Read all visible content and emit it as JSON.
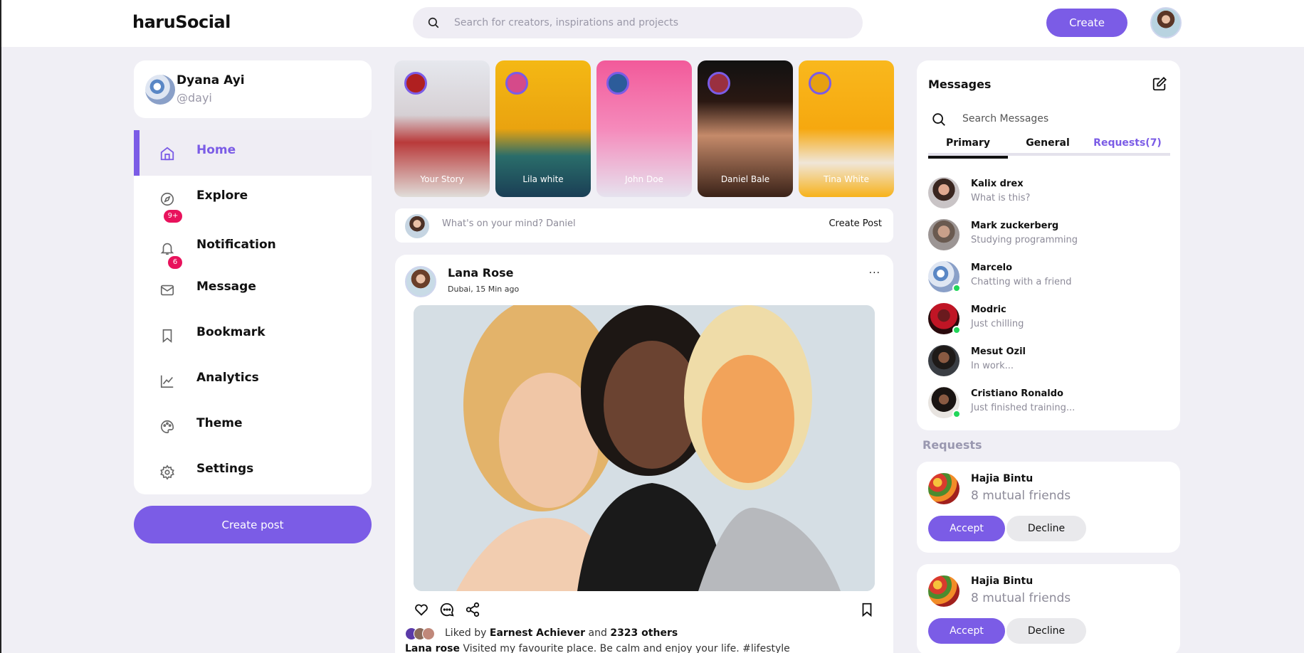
{
  "header": {
    "logo": "haruSocial",
    "search_placeholder": "Search for creators, inspirations and projects",
    "create_label": "Create"
  },
  "profile": {
    "name": "Dyana Ayi",
    "handle": "@dayi"
  },
  "menu": {
    "items": [
      {
        "label": "Home",
        "icon": "home-icon",
        "active": true
      },
      {
        "label": "Explore",
        "icon": "compass-icon"
      },
      {
        "label": "Notification",
        "icon": "bell-icon"
      },
      {
        "label": "Message",
        "icon": "mail-icon"
      },
      {
        "label": "Bookmark",
        "icon": "bookmark-icon"
      },
      {
        "label": "Analytics",
        "icon": "chart-icon"
      },
      {
        "label": "Theme",
        "icon": "palette-icon"
      },
      {
        "label": "Settings",
        "icon": "gear-icon"
      }
    ],
    "explore_badge": "9+",
    "notification_badge": "6",
    "create_post_label": "Create post"
  },
  "stories": [
    {
      "name": "Your Story"
    },
    {
      "name": "Lila white"
    },
    {
      "name": "John Doe"
    },
    {
      "name": "Daniel Bale"
    },
    {
      "name": "Tina White"
    }
  ],
  "composer": {
    "placeholder": "What's on your mind? Daniel",
    "button": "Create Post"
  },
  "post": {
    "author": "Lana Rose",
    "meta": "Dubai, 15 Min ago",
    "more": "...",
    "liked_prefix": "Liked by",
    "liked_name": "Earnest Achiever",
    "liked_and": "and",
    "liked_others": "2323 others",
    "caption_author": "Lana rose",
    "caption_text": "Visited my favourite place. Be calm and enjoy your life. #lifestyle"
  },
  "messages": {
    "title": "Messages",
    "search_placeholder": "Search Messages",
    "tabs": [
      "Primary",
      "General",
      "Requests(7)"
    ],
    "items": [
      {
        "name": "Kalix drex",
        "text": "What is this?",
        "online": false
      },
      {
        "name": "Mark zuckerberg",
        "text": "Studying programming",
        "online": false
      },
      {
        "name": "Marcelo",
        "text": "Chatting with a friend",
        "online": true
      },
      {
        "name": "Modric",
        "text": "Just chilling",
        "online": true
      },
      {
        "name": "Mesut Ozil",
        "text": "In work...",
        "online": false
      },
      {
        "name": "Cristiano Ronaldo",
        "text": "Just finished training...",
        "online": true
      }
    ]
  },
  "requests": {
    "title": "Requests",
    "items": [
      {
        "name": "Hajia Bintu",
        "mutual": "8 mutual friends",
        "accept": "Accept",
        "decline": "Decline"
      },
      {
        "name": "Hajia Bintu",
        "mutual": "8 mutual friends",
        "accept": "Accept",
        "decline": "Decline"
      }
    ]
  },
  "colors": {
    "accent": "#7b5ce6",
    "badge": "#e8125c",
    "online": "#22d65a"
  }
}
